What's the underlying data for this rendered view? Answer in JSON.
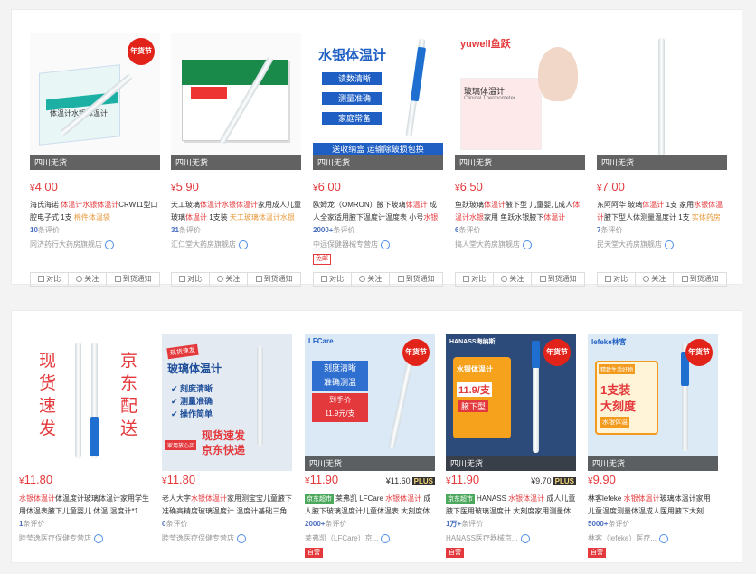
{
  "row1": [
    {
      "price": "4.00",
      "title_pre": "海氏海诺 ",
      "title_hl": "体温计水银体温计",
      "title_post": "CRW11型口腔电子式 1支 ",
      "title_gray": "棉件体温袋",
      "count": "10",
      "count_suffix": "条评价",
      "shop": "同济药行大药房旗舰店",
      "stock": "四川无货",
      "badge": "年货节"
    },
    {
      "price": "5.90",
      "title_pre": "天工玻璃",
      "title_hl": "体温计水银体温计",
      "title_post": "家用成人儿童玻璃",
      "title_hl2": "体温计",
      "title_post2": " 1支装 ",
      "title_gray": "天工玻璃体温计水银体",
      "count": "31",
      "count_suffix": "条评价",
      "shop": "汇仁堂大药房旗舰店",
      "stock": "四川无货",
      "badge": ""
    },
    {
      "price": "6.00",
      "title_pre": "欧姆龙（OMRON）腋下玻璃",
      "title_hl": "体温计",
      "title_post": " 成人全家适用腋下温度计温度表 小号",
      "title_hl2": "水银温度",
      "count": "2000+",
      "count_suffix": "条评价",
      "shop": "中远保健器械专营店",
      "stock": "四川无货",
      "badge": "",
      "sctag": "免邮",
      "img_title": "水银体温计",
      "img_items": [
        "读数清晰",
        "测量准确",
        "家庭常备"
      ],
      "img_banner": "送收纳盒 运输除破损包换"
    },
    {
      "price": "6.50",
      "title_pre": "鱼跃玻璃",
      "title_hl": "体温计",
      "title_post": "腋下型 儿童婴儿成人",
      "title_hl2": "体温计水银",
      "title_post2": "家用 鱼跃水银腋下",
      "title_hl3": "体温计",
      "count": "6",
      "count_suffix": "条评价",
      "shop": "搞人堂大药房旗舰店",
      "stock": "四川无货",
      "badge": "",
      "img_brand": "yuwell鱼跃",
      "img_sub": "玻璃体温计",
      "img_sub2": "Clinical Thermometer"
    },
    {
      "price": "7.00",
      "title_pre": "东阿阿华 玻璃",
      "title_hl": "体温计",
      "title_post": " 1支 家用",
      "title_hl2": "水银体温计",
      "title_post2": "腋下型人体测量温度计 1支 ",
      "title_gray": "实体药房",
      "count": "7",
      "count_suffix": "条评价",
      "shop": "民天堂大药房旗舰店",
      "stock": "四川无货",
      "badge": ""
    }
  ],
  "row2": [
    {
      "price": "11.80",
      "title_hl": "水银体温计",
      "title_post": "体温度计玻璃体温计家用学生用体温表腋下儿童婴儿 体温 温度计*1",
      "count": "1",
      "count_suffix": "条评价",
      "shop": "睦莹逸医疗保健专营店",
      "img_left": "现货速发",
      "img_right": "京东配送"
    },
    {
      "price": "11.80",
      "title_pre": "老人大字",
      "title_hl": "水银体温计",
      "title_post": "家用测宝宝儿童腋下准确高精度玻璃温度计 温度计基础三角",
      "count": "0",
      "count_suffix": "条评价",
      "shop": "睦莹逸医疗保健专营店",
      "img_badge": "现货速发",
      "img_title": "玻璃体温计",
      "img_items": [
        "刻度清晰",
        "测量准确",
        "操作简单"
      ],
      "img_bottom1": "现货速发",
      "img_bottom2": "京东快递",
      "img_tag": "家用放心买"
    },
    {
      "price": "11.90",
      "plus_price": "¥11.60",
      "plus": "PLUS",
      "tag": "京东超市",
      "title_pre": "莱弗凯 LFCare ",
      "title_hl": "水银体温计",
      "title_post": " 成人腋下玻璃温度计儿童体温表 大刻度体温表",
      "count": "2000+",
      "count_suffix": "条评价",
      "shop": "莱弗凯（LFCare）京...",
      "redtag": "自营",
      "stock": "四川无货",
      "badge": "年货节",
      "img_brand": "LFCare",
      "img_l1": "刻度清晰",
      "img_l2": "准确测温",
      "img_l3": "到手价",
      "img_l4": "11.9元/支"
    },
    {
      "price": "11.90",
      "plus_price": "¥9.70",
      "plus": "PLUS",
      "tag": "京东超市",
      "title_pre": "HANASS ",
      "title_hl": "水银体温计",
      "title_post": " 成人儿童腋下医用玻璃温度计 大刻度家用测量体温",
      "count": "1万+",
      "count_suffix": "条评价",
      "shop": "HANASS医疗器械京...",
      "redtag": "自营",
      "stock": "四川无货",
      "badge": "年货节",
      "img_brand": "HANASS海纳斯",
      "img_l1": "水银体温计",
      "img_l2": "11.9/支",
      "img_l3": "腋下型"
    },
    {
      "price": "9.90",
      "title_pre": "林客lefeke ",
      "title_hl": "水银体温计",
      "title_post": "玻璃体温计家用 儿童温度测量体温成人医用腋下大刻",
      "count": "5000+",
      "count_suffix": "条评价",
      "shop": "林客（lefeke）医疗...",
      "redtag": "自营",
      "stock": "四川无货",
      "badge": "年货节",
      "img_brand": "lefeke林客",
      "img_l1": "精致生活好物",
      "img_l2": "1支装",
      "img_l3": "大刻度",
      "img_l4": "水银体温"
    }
  ],
  "actions": {
    "compare": "对比",
    "follow": "关注",
    "notify": "到货通知"
  },
  "currency": "¥"
}
